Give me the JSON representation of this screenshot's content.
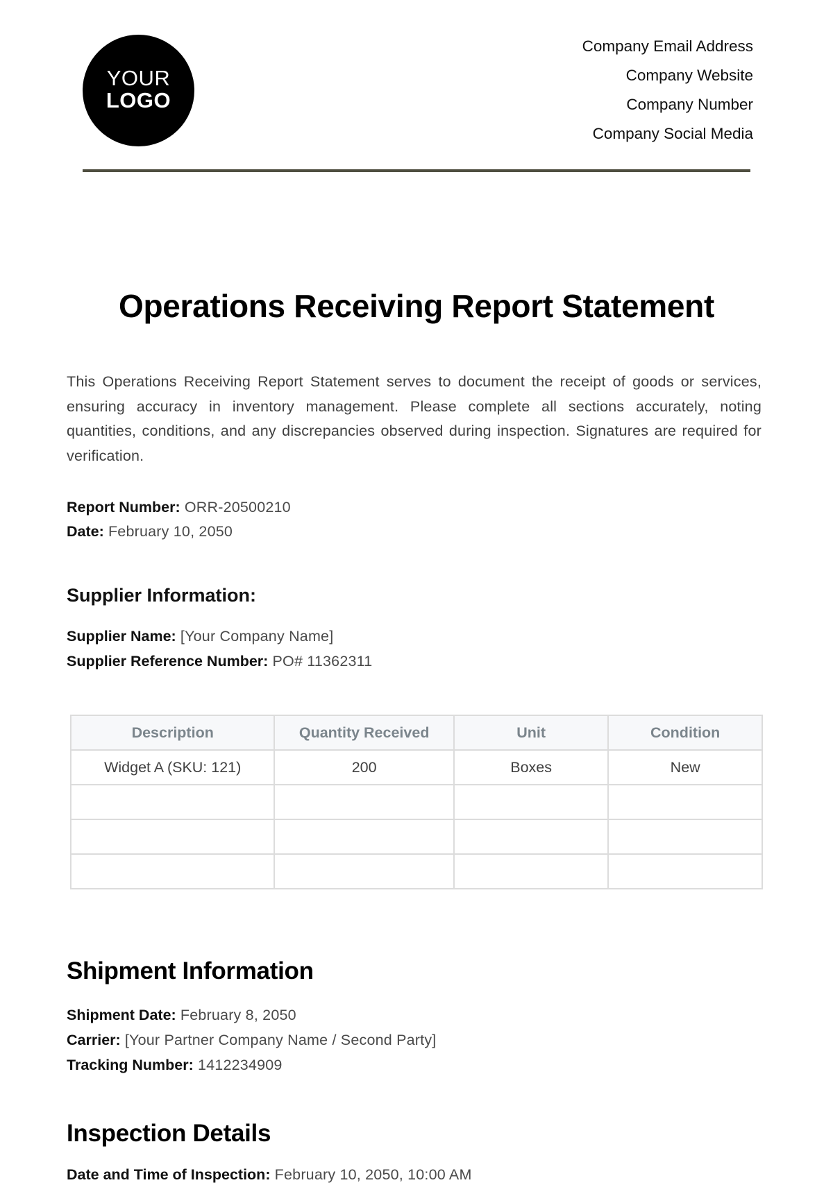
{
  "logo": {
    "line1": "YOUR",
    "line2": "LOGO"
  },
  "company_contact": [
    "Company Email Address",
    "Company Website",
    "Company Number",
    "Company Social Media"
  ],
  "document": {
    "title": "Operations Receiving Report Statement",
    "intro": "This Operations Receiving Report Statement serves to document the receipt of goods or services, ensuring accuracy in inventory management. Please complete all sections accurately, noting quantities, conditions, and any discrepancies observed during inspection. Signatures are required for verification.",
    "report_number": {
      "label": "Report Number:",
      "value": "ORR-20500210"
    },
    "date": {
      "label": "Date:",
      "value": "February 10, 2050"
    }
  },
  "supplier": {
    "heading": "Supplier Information:",
    "name": {
      "label": "Supplier Name:",
      "value": "[Your Company Name]"
    },
    "reference": {
      "label": "Supplier Reference Number:",
      "value": "PO# 11362311"
    }
  },
  "items_table": {
    "headers": [
      "Description",
      "Quantity Received",
      "Unit",
      "Condition"
    ],
    "rows": [
      [
        "Widget A (SKU: 121)",
        "200",
        "Boxes",
        "New"
      ],
      [
        "",
        "",
        "",
        ""
      ],
      [
        "",
        "",
        "",
        ""
      ],
      [
        "",
        "",
        "",
        ""
      ]
    ]
  },
  "shipment": {
    "heading": "Shipment Information",
    "date": {
      "label": "Shipment Date:",
      "value": "February 8, 2050"
    },
    "carrier": {
      "label": "Carrier:",
      "value": "[Your Partner Company Name / Second Party]"
    },
    "tracking": {
      "label": "Tracking Number:",
      "value": "1412234909"
    }
  },
  "inspection": {
    "heading": "Inspection Details",
    "datetime": {
      "label": "Date and Time of Inspection:",
      "value": "February 10, 2050, 10:00 AM"
    }
  }
}
